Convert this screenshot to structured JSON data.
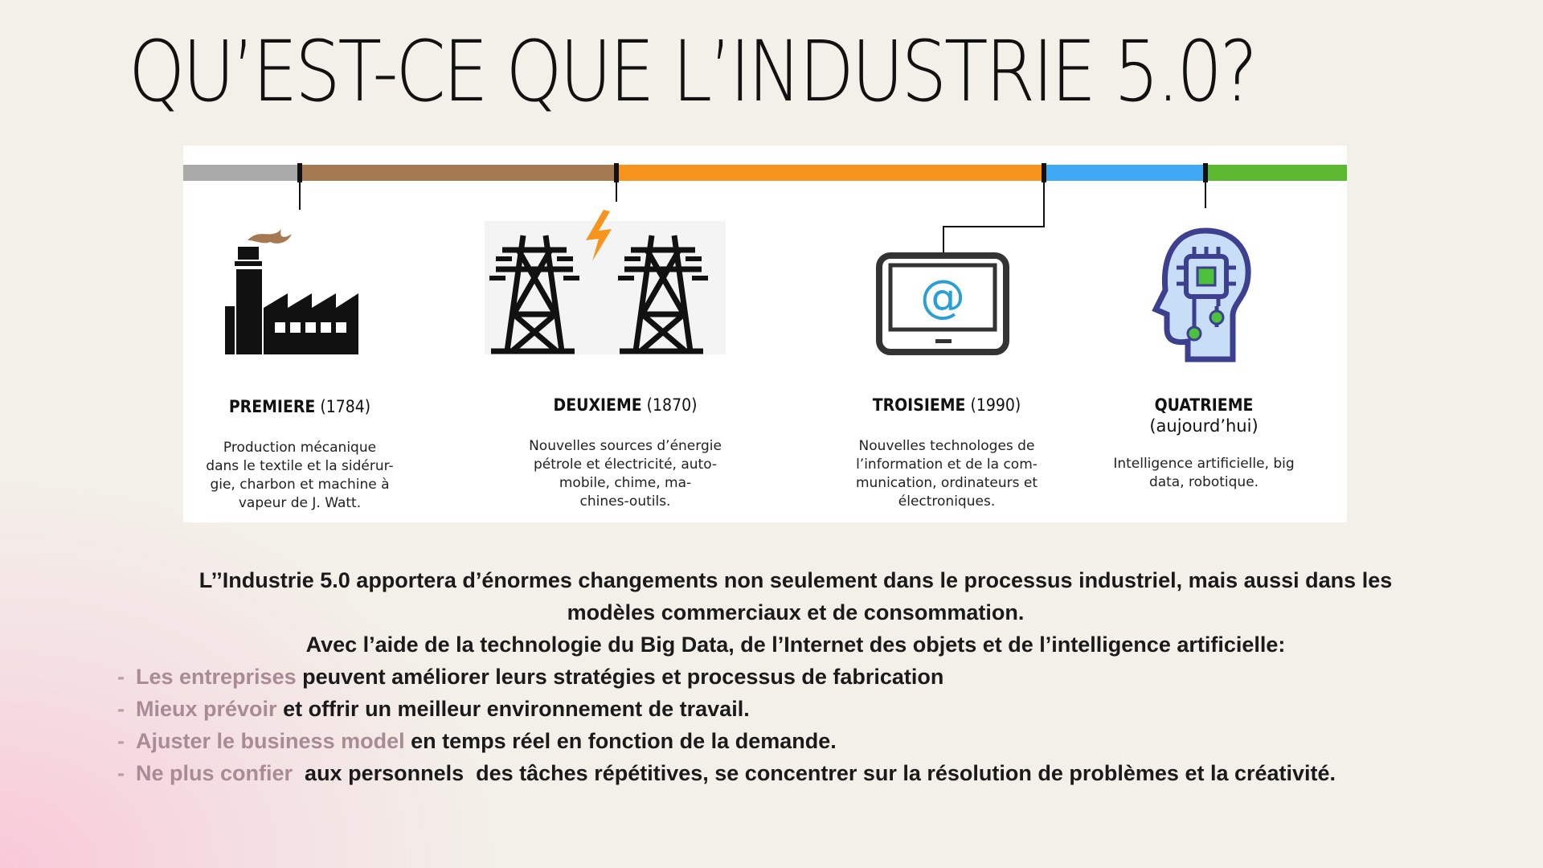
{
  "slide": {
    "title": "QU’EST-CE QUE L’INDUSTRIE 5.0?"
  },
  "timeline": {
    "bar_colors": [
      "#aaaaaa",
      "#a57a52",
      "#f7941d",
      "#3fa9f5",
      "#5cb82e"
    ],
    "eras": [
      {
        "name": "PREMIERE",
        "year": "(1784)",
        "subtitle": "",
        "desc": [
          "Production mécanique",
          "dans le textile et la sidérur-",
          "gie, charbon et machine à",
          "vapeur de J. Watt."
        ],
        "icon": "factory-icon"
      },
      {
        "name": "DEUXIEME",
        "year": "(1870)",
        "subtitle": "",
        "desc": [
          "Nouvelles sources d’énergie",
          "pétrole et électricité, auto-",
          "mobile, chime, ma-",
          "chines-outils."
        ],
        "icon": "power-pylon-icon"
      },
      {
        "name": "TROISIEME",
        "year": "(1990)",
        "subtitle": "",
        "desc": [
          "Nouvelles technologes de",
          "l’information et de la com-",
          "munication, ordinateurs et",
          "électroniques."
        ],
        "icon": "computer-icon"
      },
      {
        "name": "QUATRIEME",
        "year": "",
        "subtitle": "(aujourd’hui)",
        "desc": [
          "Intelligence artificielle, big",
          "data, robotique."
        ],
        "icon": "ai-head-icon"
      }
    ]
  },
  "body": {
    "para1_line1": "L’’Industrie 5.0 apportera d’énormes changements non seulement dans le processus industriel, mais aussi dans les",
    "para1_line2": "modèles commerciaux et de consommation.",
    "para2": "Avec l’aide de la technologie du Big Data, de l’Internet des objets et de l’intelligence artificielle:",
    "bullets": [
      {
        "muted": "Les entreprises",
        "rest": " peuvent améliorer leurs stratégies et processus de fabrication"
      },
      {
        "muted": "Mieux prévoir",
        "rest": " et offrir un meilleur environnement de travail."
      },
      {
        "muted": "Ajuster le business model",
        "rest": " en temps réel en fonction de la demande."
      },
      {
        "muted": "Ne plus confier ",
        "rest": " aux personnels  des tâches répétitives, se concentrer sur la résolution de problèmes et la créativité."
      }
    ]
  }
}
